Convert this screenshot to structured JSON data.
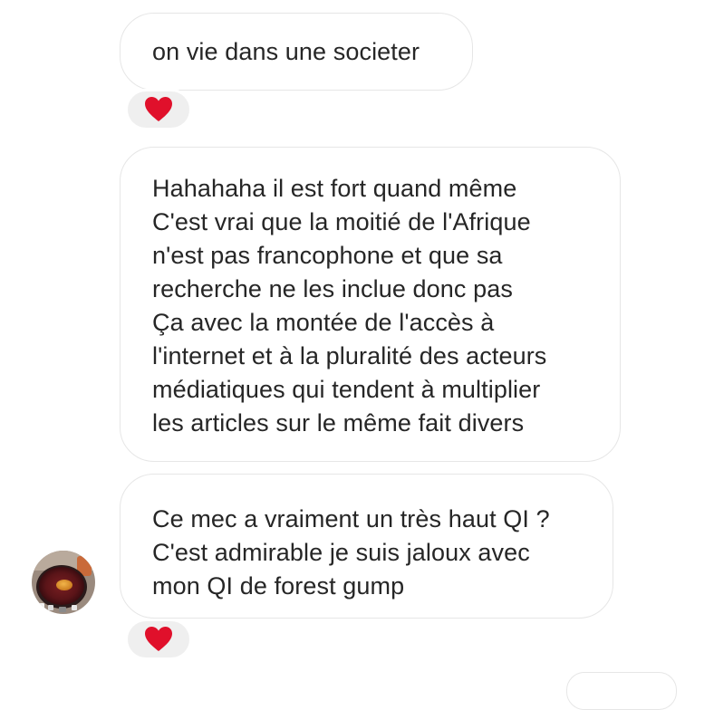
{
  "conversation": {
    "messages": [
      {
        "lines": [
          "on vie dans une societer"
        ],
        "reaction": {
          "emoji": "heart",
          "color": "#e0102b"
        }
      },
      {
        "lines": [
          "Hahahaha il est fort quand même",
          "C'est vrai que la moitié de l'Afrique",
          "n'est pas francophone et que sa",
          "recherche ne les inclue donc pas",
          "Ça avec la montée de l'accès à",
          "l'internet et à la pluralité des acteurs",
          "médiatiques qui tendent à multiplier",
          "les articles sur le même fait divers"
        ]
      },
      {
        "lines": [
          "Ce mec a vraiment un très haut QI ?",
          "C'est admirable je suis jaloux avec",
          "mon QI de forest gump"
        ],
        "reaction": {
          "emoji": "heart",
          "color": "#e0102b"
        },
        "sender_avatar": "profile-photo"
      }
    ]
  },
  "theme": {
    "bubble_border": "#e6e6e6",
    "reaction_bg": "#efefef",
    "text_color": "#262626",
    "heart_color": "#e0102b"
  }
}
